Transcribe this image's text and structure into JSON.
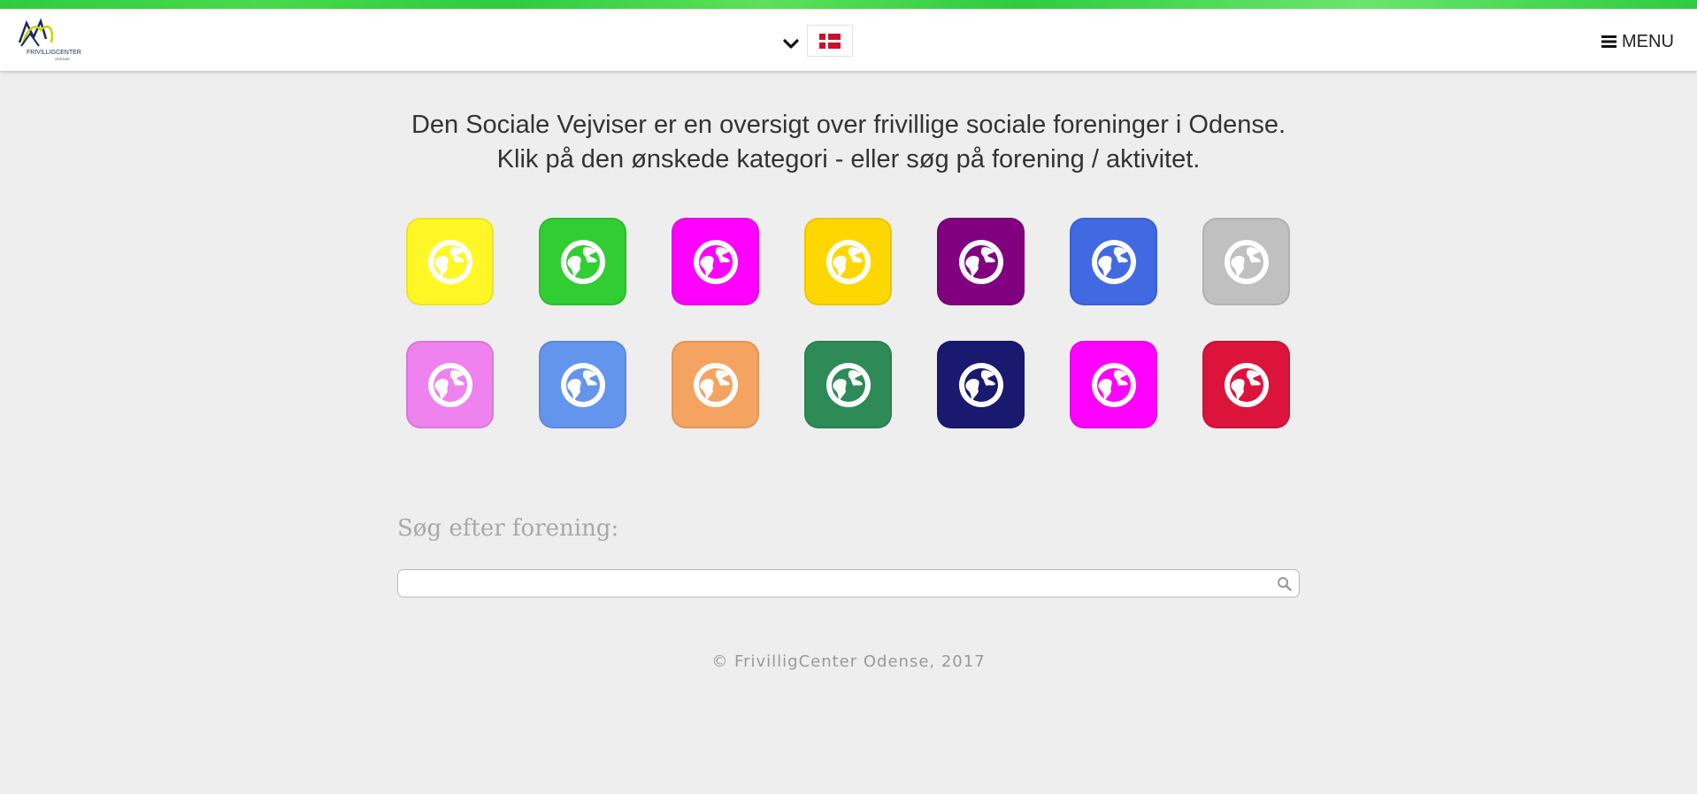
{
  "header": {
    "logo_text": "FRIVILLIGCENTER",
    "logo_subtext": "ODENSE",
    "language_selected": "Dansk (Danish flag)",
    "menu_label": "MENU"
  },
  "intro": {
    "line1": "Den Sociale Vejviser er en oversigt over frivillige sociale foreninger i Odense.",
    "line2": "Klik på den ønskede kategori - eller søg på forening / aktivitet."
  },
  "categories": [
    {
      "icon": "globe-icon",
      "color": "#fff826"
    },
    {
      "icon": "globe-icon",
      "color": "#32cd32"
    },
    {
      "icon": "globe-icon",
      "color": "#ff00ff"
    },
    {
      "icon": "globe-icon",
      "color": "#ffd700"
    },
    {
      "icon": "globe-icon",
      "color": "#800080"
    },
    {
      "icon": "globe-icon",
      "color": "#4169e1"
    },
    {
      "icon": "globe-icon",
      "color": "#c0c0c0"
    },
    {
      "icon": "globe-icon",
      "color": "#ee82ee"
    },
    {
      "icon": "globe-icon",
      "color": "#6495ed"
    },
    {
      "icon": "globe-icon",
      "color": "#f4a460"
    },
    {
      "icon": "globe-icon",
      "color": "#2e8b57"
    },
    {
      "icon": "globe-icon",
      "color": "#191970"
    },
    {
      "icon": "globe-icon",
      "color": "#ff00ff"
    },
    {
      "icon": "globe-icon",
      "color": "#dc143c"
    }
  ],
  "search": {
    "label": "Søg efter forening:",
    "value": "",
    "placeholder": ""
  },
  "footer": {
    "text": "© FrivilligCenter Odense, 2017"
  },
  "colors": {
    "top_strip": "#2ecc40",
    "background": "#eeeeee",
    "header_bg": "#ffffff"
  }
}
